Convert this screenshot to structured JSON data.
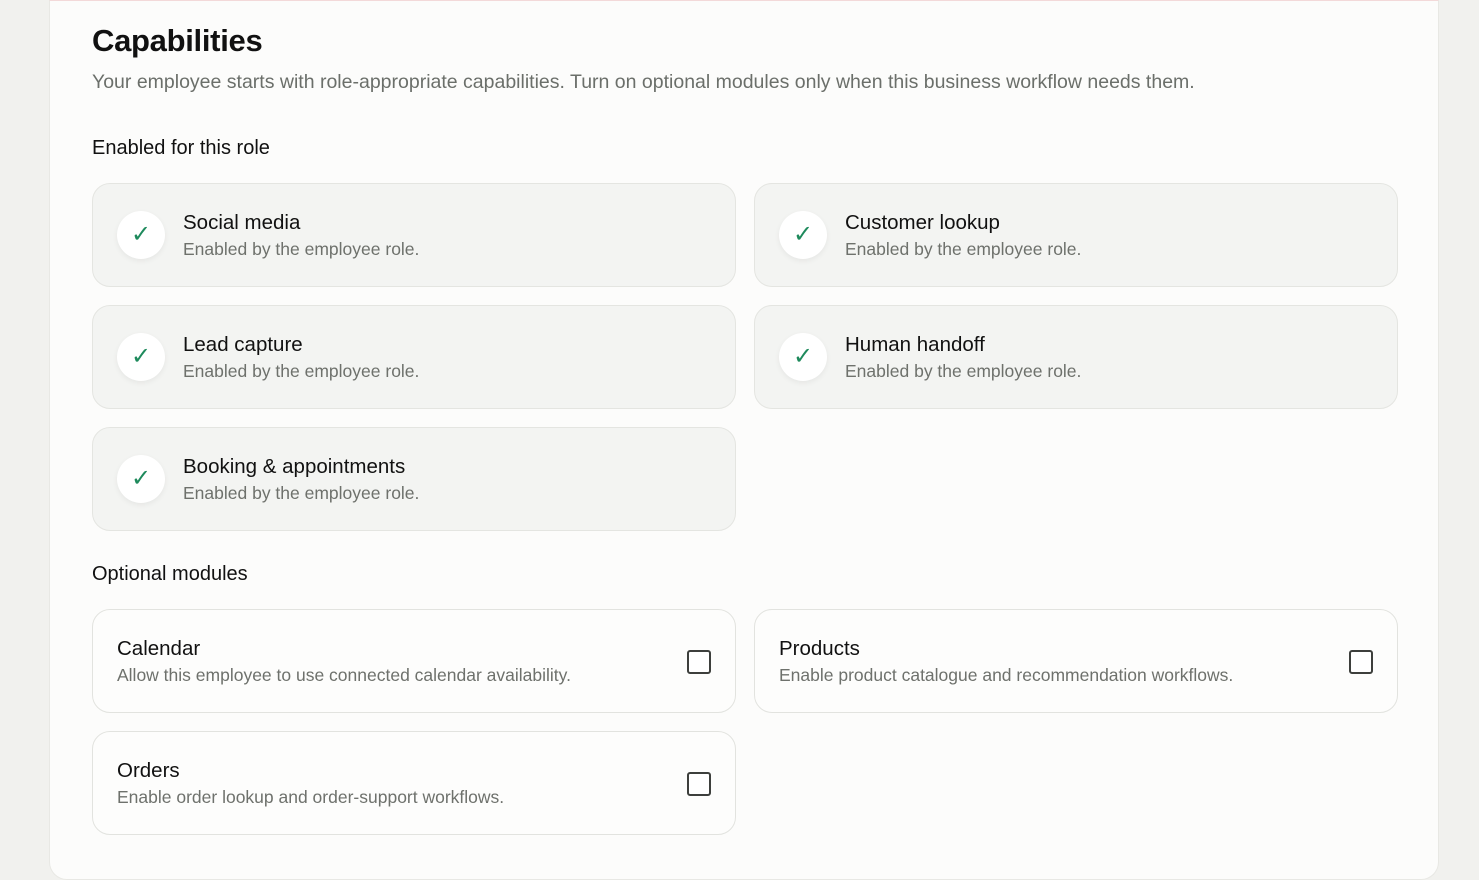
{
  "header": {
    "title": "Capabilities",
    "subtitle": "Your employee starts with role-appropriate capabilities. Turn on optional modules only when this business workflow needs them."
  },
  "enabled_section": {
    "heading": "Enabled for this role",
    "items": [
      {
        "title": "Social media",
        "description": "Enabled by the employee role.",
        "icon": "check-icon"
      },
      {
        "title": "Customer lookup",
        "description": "Enabled by the employee role.",
        "icon": "check-icon"
      },
      {
        "title": "Lead capture",
        "description": "Enabled by the employee role.",
        "icon": "check-icon"
      },
      {
        "title": "Human handoff",
        "description": "Enabled by the employee role.",
        "icon": "check-icon"
      },
      {
        "title": "Booking & appointments",
        "description": "Enabled by the employee role.",
        "icon": "check-icon"
      }
    ]
  },
  "optional_section": {
    "heading": "Optional modules",
    "items": [
      {
        "title": "Calendar",
        "description": "Allow this employee to use connected calendar availability.",
        "checked": false
      },
      {
        "title": "Products",
        "description": "Enable product catalogue and recommendation workflows.",
        "checked": false
      },
      {
        "title": "Orders",
        "description": "Enable order lookup and order-support workflows.",
        "checked": false
      }
    ]
  },
  "colors": {
    "check_accent": "#1e8a5c",
    "page_background": "#f1f1ee",
    "panel_background": "#fcfcfb"
  }
}
